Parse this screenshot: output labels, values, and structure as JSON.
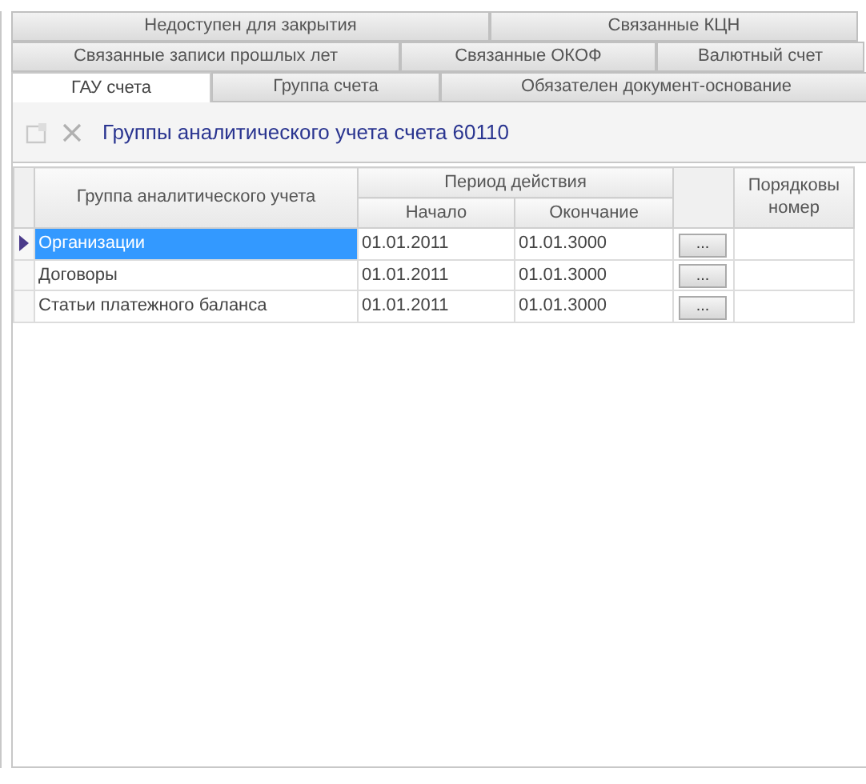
{
  "tab_rows": [
    [
      {
        "label": "Недоступен для закрытия",
        "selected": false
      },
      {
        "label": "Связанные КЦН",
        "selected": false
      }
    ],
    [
      {
        "label": "Связанные записи прошлых лет",
        "selected": false
      },
      {
        "label": "Связанные ОКОФ",
        "selected": false
      },
      {
        "label": "Валютный счет",
        "selected": false
      }
    ],
    [
      {
        "label": "ГАУ счета",
        "selected": true
      },
      {
        "label": "Группа счета",
        "selected": false
      },
      {
        "label": "Обязателен документ-основание",
        "selected": false
      }
    ]
  ],
  "toolbar": {
    "add_disabled": true,
    "delete_disabled": true,
    "title": "Группы аналитического учета счета 60110"
  },
  "table": {
    "columns": {
      "group": "Группа аналитического учета",
      "period": "Период действия",
      "start": "Начало",
      "end": "Окончание",
      "order": "Порядковы номер"
    },
    "rows": [
      {
        "group": "Организации",
        "start": "01.01.2011",
        "end": "01.01.3000",
        "button": "...",
        "selected": true
      },
      {
        "group": "Договоры",
        "start": "01.01.2011",
        "end": "01.01.3000",
        "button": "...",
        "selected": false
      },
      {
        "group": "Статьи платежного баланса",
        "start": "01.01.2011",
        "end": "01.01.3000",
        "button": "...",
        "selected": false
      }
    ]
  }
}
